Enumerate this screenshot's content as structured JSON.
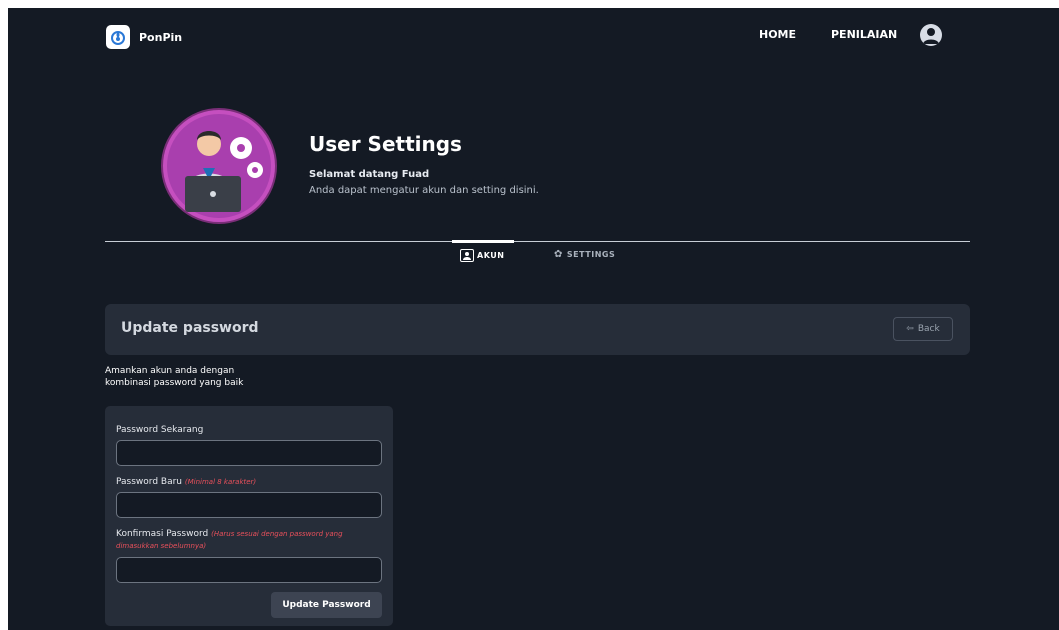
{
  "navbar": {
    "brand_name": "PonPin",
    "links": [
      "HOME",
      "PENILAIAN"
    ]
  },
  "hero": {
    "title": "User Settings",
    "welcome": "Selamat datang Fuad",
    "description": "Anda dapat mengatur akun dan setting disini."
  },
  "tabs": [
    {
      "label": "AKUN",
      "icon": "user-icon",
      "active": true
    },
    {
      "label": "SETTINGS",
      "icon": "gear-icon",
      "active": false
    }
  ],
  "section": {
    "title": "Update password",
    "back_label": "Back"
  },
  "hint": "Amankan akun anda dengan kombinasi password yang baik",
  "form": {
    "current_label": "Password Sekarang",
    "current_value": "",
    "new_label": "Password Baru",
    "new_note": "(Minimal 8 karakter)",
    "new_value": "",
    "confirm_label": "Konfirmasi Password",
    "confirm_note": "(Harus sesuai dengan password yang dimasukkan sebelumnya)",
    "confirm_value": "",
    "submit_label": "Update Password"
  },
  "colors": {
    "background": "#141a24",
    "panel": "#262d39",
    "note_red": "#e8505b",
    "avatar_purple": "#c54fbf"
  }
}
